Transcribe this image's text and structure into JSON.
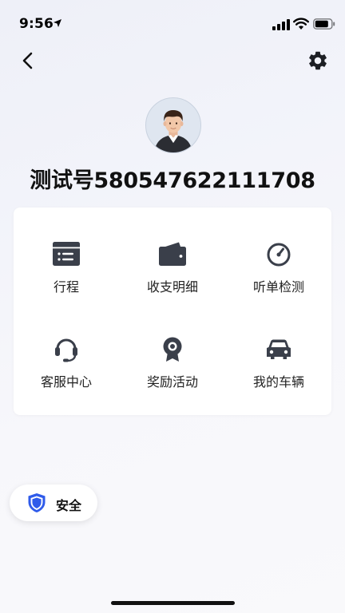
{
  "status_bar": {
    "time": "9:56",
    "icons": [
      "location-arrow-icon",
      "signal-icon",
      "wifi-icon",
      "battery-icon"
    ]
  },
  "header": {
    "back_icon": "chevron-left-icon",
    "settings_icon": "gear-icon"
  },
  "profile": {
    "avatar_icon": "user-avatar",
    "name": "测试号580547622111708"
  },
  "menu": {
    "items": [
      {
        "label": "行程",
        "icon": "trip-list-icon"
      },
      {
        "label": "收支明细",
        "icon": "wallet-icon"
      },
      {
        "label": "听单检测",
        "icon": "gauge-icon"
      },
      {
        "label": "客服中心",
        "icon": "headset-icon"
      },
      {
        "label": "奖励活动",
        "icon": "award-badge-icon"
      },
      {
        "label": "我的车辆",
        "icon": "car-icon"
      }
    ]
  },
  "safety": {
    "label": "安全",
    "icon": "shield-icon",
    "accent_color": "#2f5bea"
  },
  "colors": {
    "icon": "#3a3f4a",
    "text": "#222222",
    "card": "#ffffff"
  }
}
